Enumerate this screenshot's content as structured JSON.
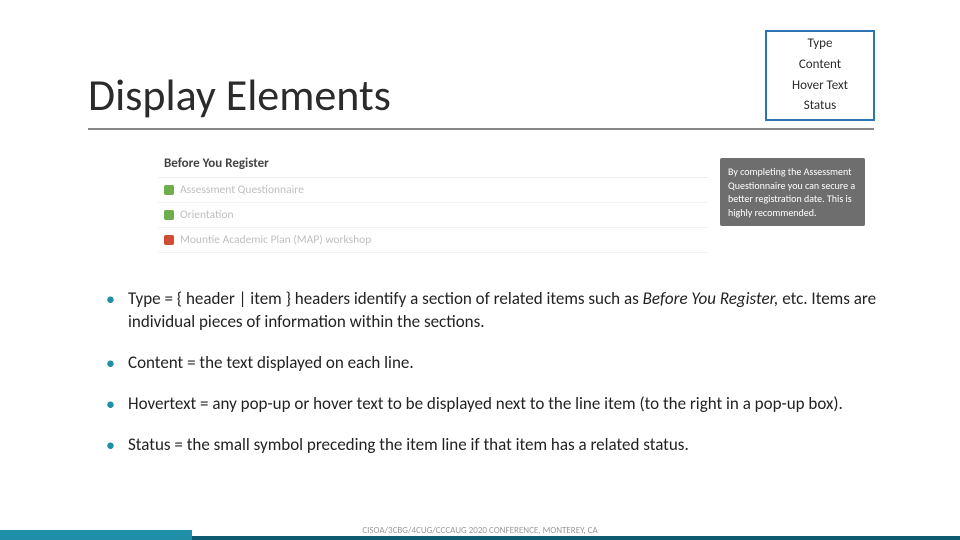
{
  "title": "Display Elements",
  "box": {
    "line1": "Type",
    "line2": "Content",
    "line3": "Hover Text",
    "line4": "Status"
  },
  "example": {
    "header": "Before You Register",
    "rows": [
      {
        "status": "check-green",
        "label": "Assessment Questionnaire"
      },
      {
        "status": "check-green2",
        "label": "Orientation"
      },
      {
        "status": "x-red",
        "label": "Mountie Academic Plan (MAP) workshop"
      }
    ]
  },
  "hover_popup": "By completing the Assessment Questionnaire you can secure a better registration date. This is highly recommended.",
  "bullets": [
    "Type = { header | item } headers identify a section of related items such as <em>Before You Register,</em> etc. Items are individual pieces of information within the sections.",
    "Content = the text displayed on each line.",
    "Hovertext = any pop-up or hover text to be displayed next to the line item (to the right in a pop-up box).",
    "Status = the small symbol preceding the item line if that item has a related status."
  ],
  "footer": "CISOA/3CBG/4CUG/CCCAUG 2020 CONFERENCE, MONTEREY, CA"
}
